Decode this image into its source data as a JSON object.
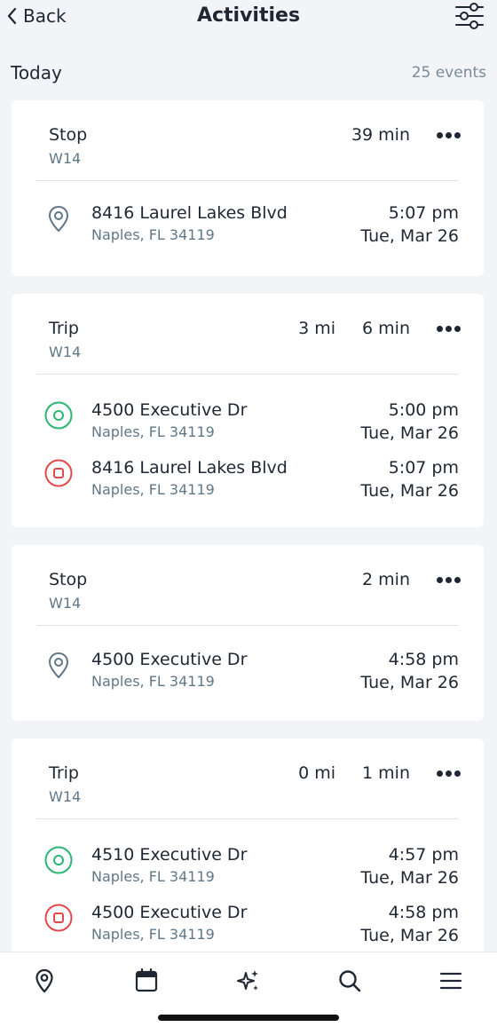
{
  "header": {
    "back_label": "Back",
    "title": "Activities",
    "back_icon": "chevron-left-icon",
    "filter_icon": "sliders-icon"
  },
  "section": {
    "day": "Today",
    "count": "25 events"
  },
  "cards": [
    {
      "type": "Stop",
      "vehicle": "W14",
      "duration": "39 min",
      "rows": [
        {
          "icon": "location-pin-icon",
          "address": "8416 Laurel Lakes Blvd",
          "city": "Naples, FL 34119",
          "time": "5:07 pm",
          "date": "Tue, Mar 26"
        }
      ]
    },
    {
      "type": "Trip",
      "vehicle": "W14",
      "distance": "3 mi",
      "duration": "6 min",
      "rows": [
        {
          "icon": "start-circle-icon",
          "address": "4500 Executive Dr",
          "city": "Naples, FL 34119",
          "time": "5:00 pm",
          "date": "Tue, Mar 26"
        },
        {
          "icon": "end-square-icon",
          "address": "8416 Laurel Lakes Blvd",
          "city": "Naples, FL 34119",
          "time": "5:07 pm",
          "date": "Tue, Mar 26"
        }
      ]
    },
    {
      "type": "Stop",
      "vehicle": "W14",
      "duration": "2 min",
      "rows": [
        {
          "icon": "location-pin-icon",
          "address": "4500 Executive Dr",
          "city": "Naples, FL 34119",
          "time": "4:58 pm",
          "date": "Tue, Mar 26"
        }
      ]
    },
    {
      "type": "Trip",
      "vehicle": "W14",
      "distance": "0 mi",
      "duration": "1 min",
      "rows": [
        {
          "icon": "start-circle-icon",
          "address": "4510 Executive Dr",
          "city": "Naples, FL 34119",
          "time": "4:57 pm",
          "date": "Tue, Mar 26"
        },
        {
          "icon": "end-square-icon",
          "address": "4500 Executive Dr",
          "city": "Naples, FL 34119",
          "time": "4:58 pm",
          "date": "Tue, Mar 26"
        }
      ]
    }
  ],
  "nav": [
    "location-pin-icon",
    "calendar-icon",
    "sparkles-icon",
    "search-icon",
    "menu-icon"
  ],
  "colors": {
    "start_green": "#2bb673",
    "end_red": "#e5484d",
    "pin_gray": "#5f7888",
    "background": "#f2f4f7"
  }
}
